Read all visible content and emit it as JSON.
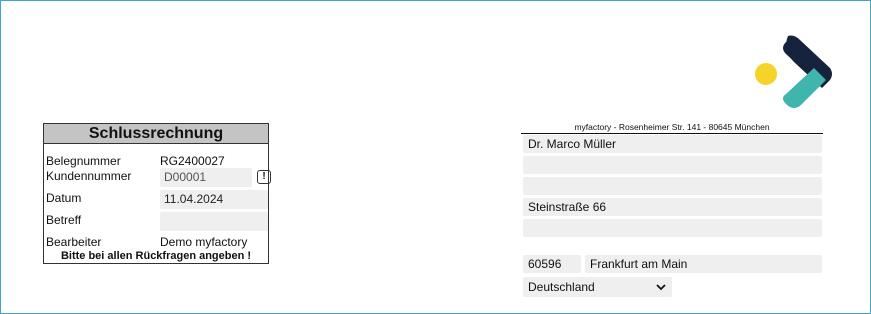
{
  "document": {
    "title": "Schlussrechnung",
    "fields": {
      "belegnummer": {
        "label": "Belegnummer",
        "value": "RG2400027"
      },
      "kundennummer": {
        "label": "Kundennummer",
        "value": "D00001"
      },
      "datum": {
        "label": "Datum",
        "value": "11.04.2024"
      },
      "betreff": {
        "label": "Betreff",
        "value": ""
      },
      "bearbeiter": {
        "label": "Bearbeiter",
        "value": "Demo myfactory"
      }
    },
    "note": "Bitte bei allen Rückfragen angeben !",
    "info_button_label": "!"
  },
  "address": {
    "sender_line": "myfactory - Rosenheimer Str. 141 - 80645 München",
    "name": "Dr. Marco Müller",
    "line2": "",
    "line3": "",
    "street": "Steinstraße 66",
    "line5": "",
    "zip": "60596",
    "city": "Frankfurt am Main",
    "country": "Deutschland"
  },
  "logo": {
    "icon": "myfactory-logo",
    "colors": {
      "dot": "#f5d328",
      "dark": "#16233d",
      "teal": "#3fb5ad"
    }
  },
  "colors": {
    "frame": "#3fa6c9",
    "field_bg": "#efefef",
    "header_bg": "#c4c4c4"
  }
}
